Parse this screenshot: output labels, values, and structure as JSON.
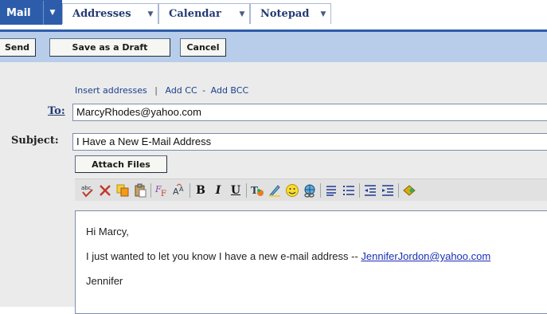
{
  "tabs": [
    {
      "label": "Mail"
    },
    {
      "label": "Addresses"
    },
    {
      "label": "Calendar"
    },
    {
      "label": "Notepad"
    }
  ],
  "toolbar": {
    "send_label": "Send",
    "draft_label": "Save as a Draft",
    "cancel_label": "Cancel"
  },
  "compose": {
    "insert_addresses": "Insert addresses",
    "separator": "|",
    "add_cc": "Add CC",
    "dash": "-",
    "add_bcc": "Add BCC",
    "to_label": "To:",
    "to_value": "MarcyRhodes@yahoo.com",
    "subject_label": "Subject:",
    "subject_value": "I Have a New E-Mail Address",
    "attach_label": "Attach Files"
  },
  "format_icons": [
    "spellcheck-icon",
    "cut-icon",
    "copy-icon",
    "paste-icon",
    "font-icon",
    "font-size-icon",
    "bold-icon",
    "italic-icon",
    "underline-icon",
    "text-color-icon",
    "highlight-icon",
    "emoticon-icon",
    "link-icon",
    "bullet-list-icon",
    "numbered-list-icon",
    "outdent-icon",
    "indent-icon",
    "stationery-icon"
  ],
  "body": {
    "greeting": "Hi Marcy,",
    "message": "I just wanted to let you know I have a new e-mail address --",
    "link": "JenniferJordon@yahoo.com",
    "signature": "Jennifer"
  },
  "colors": {
    "brand_blue": "#2d5daa",
    "toolbar_bg": "#b7cdea",
    "compose_bg": "#ebebeb",
    "label_navy": "#233a73"
  }
}
